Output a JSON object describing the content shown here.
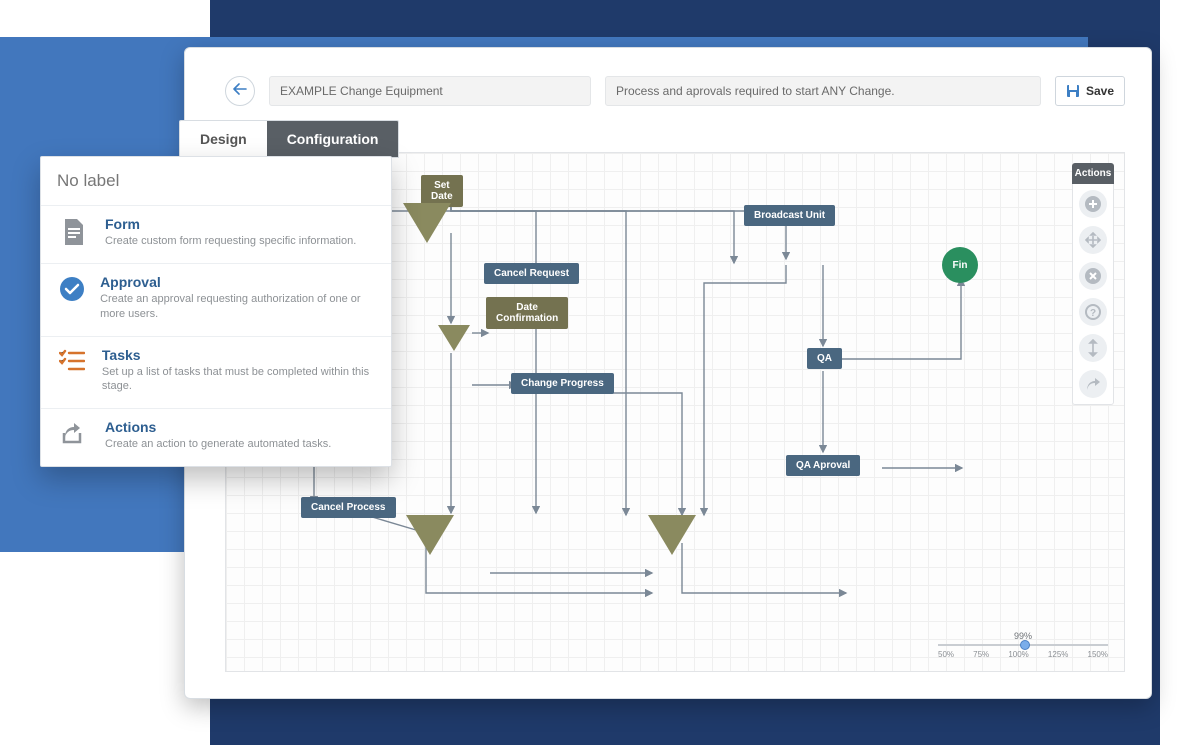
{
  "toolbar": {
    "title": "EXAMPLE Change Equipment",
    "description": "Process and aprovals required to start ANY Change.",
    "save_label": "Save"
  },
  "tabs": {
    "design": "Design",
    "configuration": "Configuration"
  },
  "popup": {
    "title": "No label",
    "items": [
      {
        "title": "Form",
        "desc": "Create custom form requesting specific information."
      },
      {
        "title": "Approval",
        "desc": "Create an approval requesting authorization of one or more users."
      },
      {
        "title": "Tasks",
        "desc": "Set up a list of tasks that must be completed within this stage."
      },
      {
        "title": "Actions",
        "desc": "Create an action to generate automated tasks."
      }
    ]
  },
  "actions_panel": {
    "header": "Actions"
  },
  "nodes": {
    "set_date": "Set\nDate",
    "broadcast_unit": "Broadcast Unit",
    "cancel_request": "Cancel Request",
    "date_confirmation": "Date\nConfirmation",
    "change_progress": "Change Progress",
    "qa": "QA",
    "qa_aproval": "QA Aproval",
    "cancel_process": "Cancel Process",
    "fin": "Fin"
  },
  "zoom": {
    "value": "99%",
    "labels": [
      "50%",
      "75%",
      "100%",
      "125%",
      "150%"
    ]
  }
}
